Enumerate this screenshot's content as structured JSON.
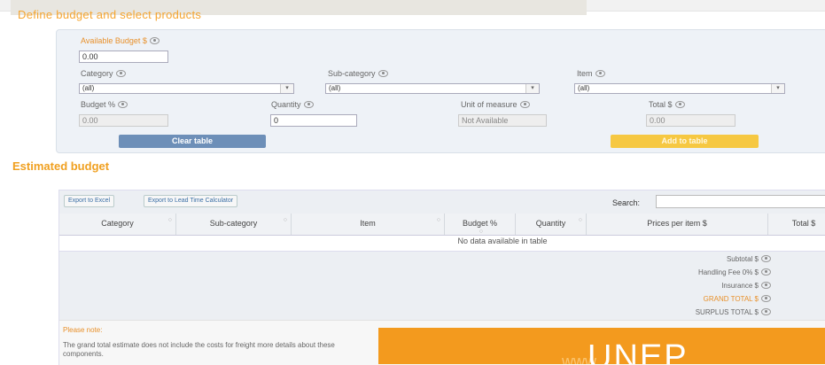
{
  "section_define": {
    "title": "Define budget and select products"
  },
  "form": {
    "available_budget": {
      "label": "Available Budget $",
      "value": "0.00"
    },
    "category": {
      "label": "Category",
      "value": "(all)"
    },
    "subcategory": {
      "label": "Sub-category",
      "value": "(all)"
    },
    "item": {
      "label": "Item",
      "value": "(all)"
    },
    "budget_pct": {
      "label": "Budget %",
      "value": "0.00"
    },
    "quantity": {
      "label": "Quantity",
      "value": "0"
    },
    "unit_of_measure": {
      "label": "Unit of measure",
      "value": "Not Available"
    },
    "total": {
      "label": "Total $",
      "value": "0.00"
    },
    "clear_button": "Clear table",
    "add_button": "Add to table"
  },
  "section_estimated": {
    "title": "Estimated budget"
  },
  "table": {
    "export_excel": "Export to Excel",
    "export_lead": "Export to Lead Time Calculator",
    "search_label": "Search:",
    "columns": [
      "Category",
      "Sub-category",
      "Item",
      "Budget %",
      "Quantity",
      "Prices per item $",
      "Total $"
    ],
    "empty": "No data available in table",
    "summary": [
      "Subtotal $",
      "Handling Fee 0% $",
      "Insurance $",
      "GRAND TOTAL $",
      "SURPLUS TOTAL $"
    ]
  },
  "note": {
    "title": "Please note:",
    "text": "The grand total estimate does not include the costs for freight more details about these components."
  },
  "banner": {
    "url_fragment": "www.",
    "text": "UNEP"
  },
  "colors": {
    "accent_orange": "#f39a1e",
    "clear_blue": "#6d8fb8",
    "add_yellow": "#f6c842"
  }
}
